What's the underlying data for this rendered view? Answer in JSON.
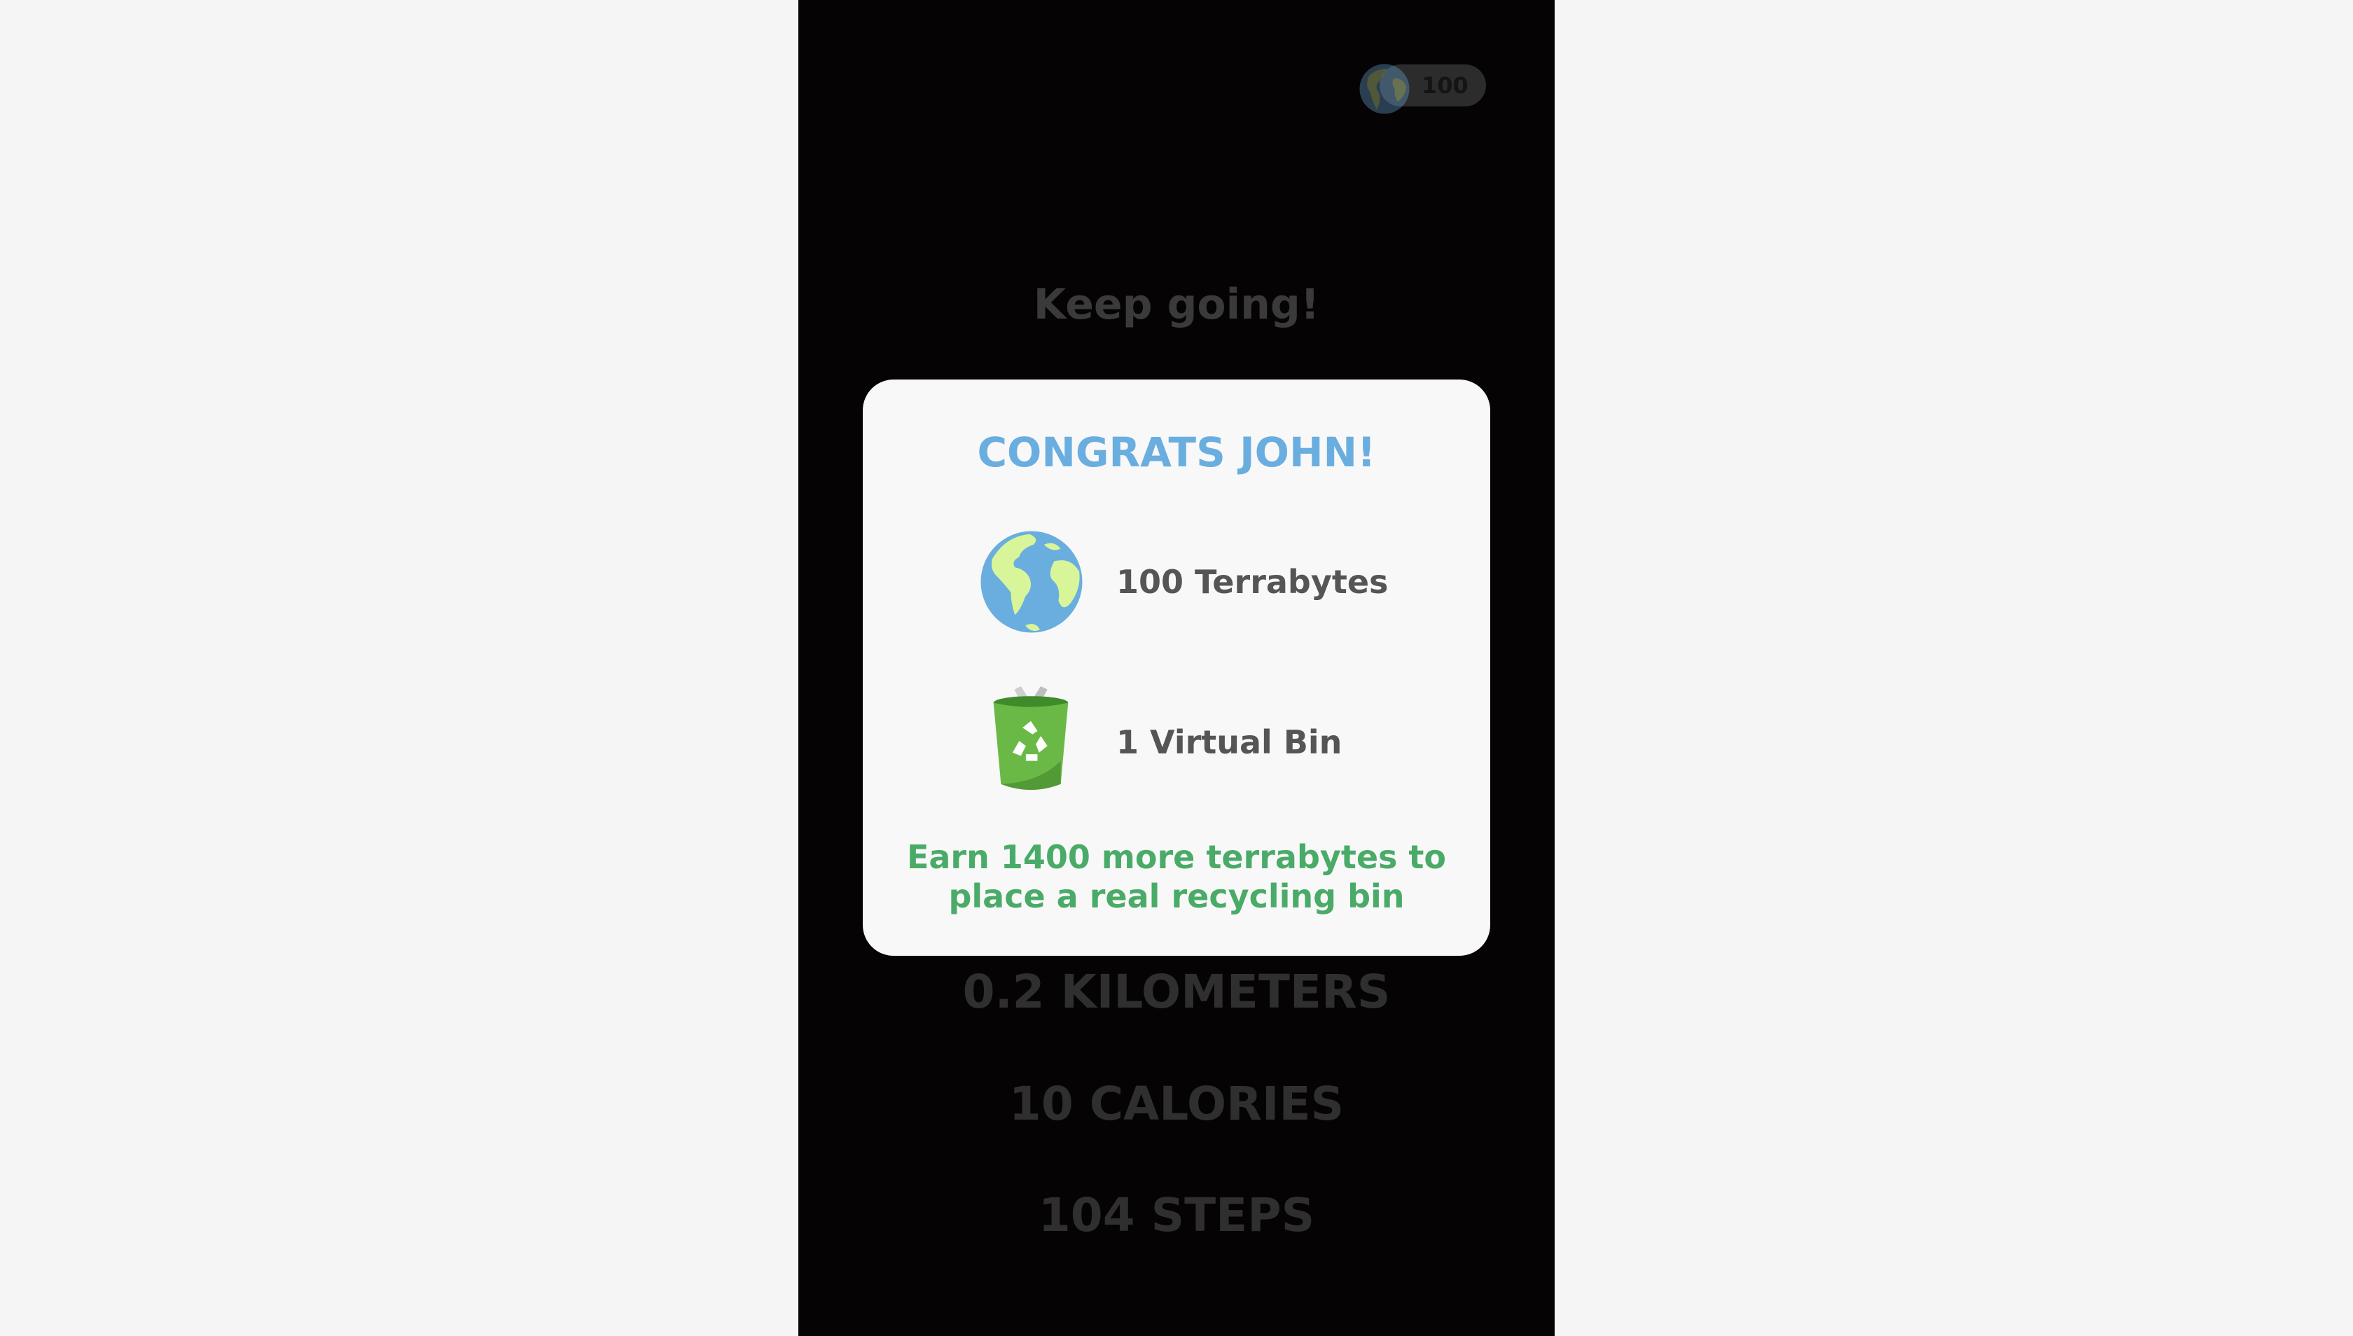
{
  "header": {
    "points_badge": "100",
    "icon": "earth-icon"
  },
  "main": {
    "message": "Keep going!",
    "stats": [
      "0.2 KILOMETERS",
      "10 CALORIES",
      "104 STEPS"
    ]
  },
  "modal": {
    "title": "CONGRATS JOHN!",
    "rewards": [
      {
        "icon": "earth-icon",
        "label": "100 Terrabytes"
      },
      {
        "icon": "recycle-bin-icon",
        "label": "1 Virtual Bin"
      }
    ],
    "earn_line1": "Earn 1400 more terrabytes to",
    "earn_line2": "place a real recycling bin"
  },
  "colors": {
    "title": "#6aaee0",
    "earn": "#4aab68",
    "ocean": "#6aaee0",
    "land": "#d9f59a",
    "bin": "#6ab946"
  }
}
